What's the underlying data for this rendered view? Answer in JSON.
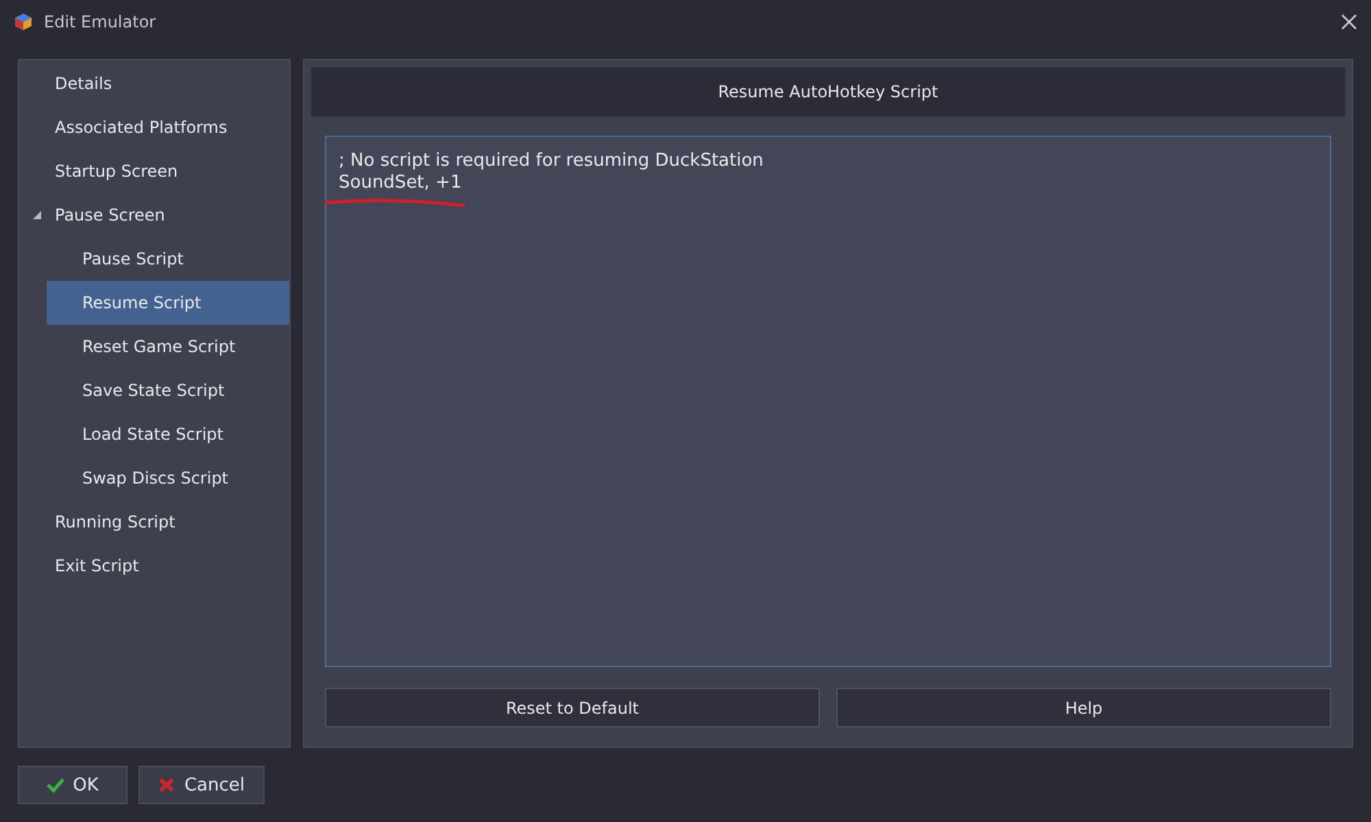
{
  "window": {
    "title": "Edit Emulator"
  },
  "sidebar": {
    "items": [
      {
        "label": "Details",
        "selected": false
      },
      {
        "label": "Associated Platforms",
        "selected": false
      },
      {
        "label": "Startup Screen",
        "selected": false
      },
      {
        "label": "Pause Screen",
        "selected": false,
        "expanded": true,
        "children": [
          {
            "label": "Pause Script",
            "selected": false
          },
          {
            "label": "Resume Script",
            "selected": true
          },
          {
            "label": "Reset Game Script",
            "selected": false
          },
          {
            "label": "Save State Script",
            "selected": false
          },
          {
            "label": "Load State Script",
            "selected": false
          },
          {
            "label": "Swap Discs Script",
            "selected": false
          }
        ]
      },
      {
        "label": "Running Script",
        "selected": false
      },
      {
        "label": "Exit Script",
        "selected": false
      }
    ]
  },
  "panel": {
    "title": "Resume AutoHotkey Script",
    "script_lines": [
      "; No script is required for resuming DuckStation",
      "SoundSet, +1"
    ],
    "buttons": [
      "Reset to Default",
      "Help"
    ]
  },
  "footer_buttons": [
    {
      "kind": "ok",
      "label": "OK"
    },
    {
      "kind": "cancel",
      "label": "Cancel"
    }
  ]
}
